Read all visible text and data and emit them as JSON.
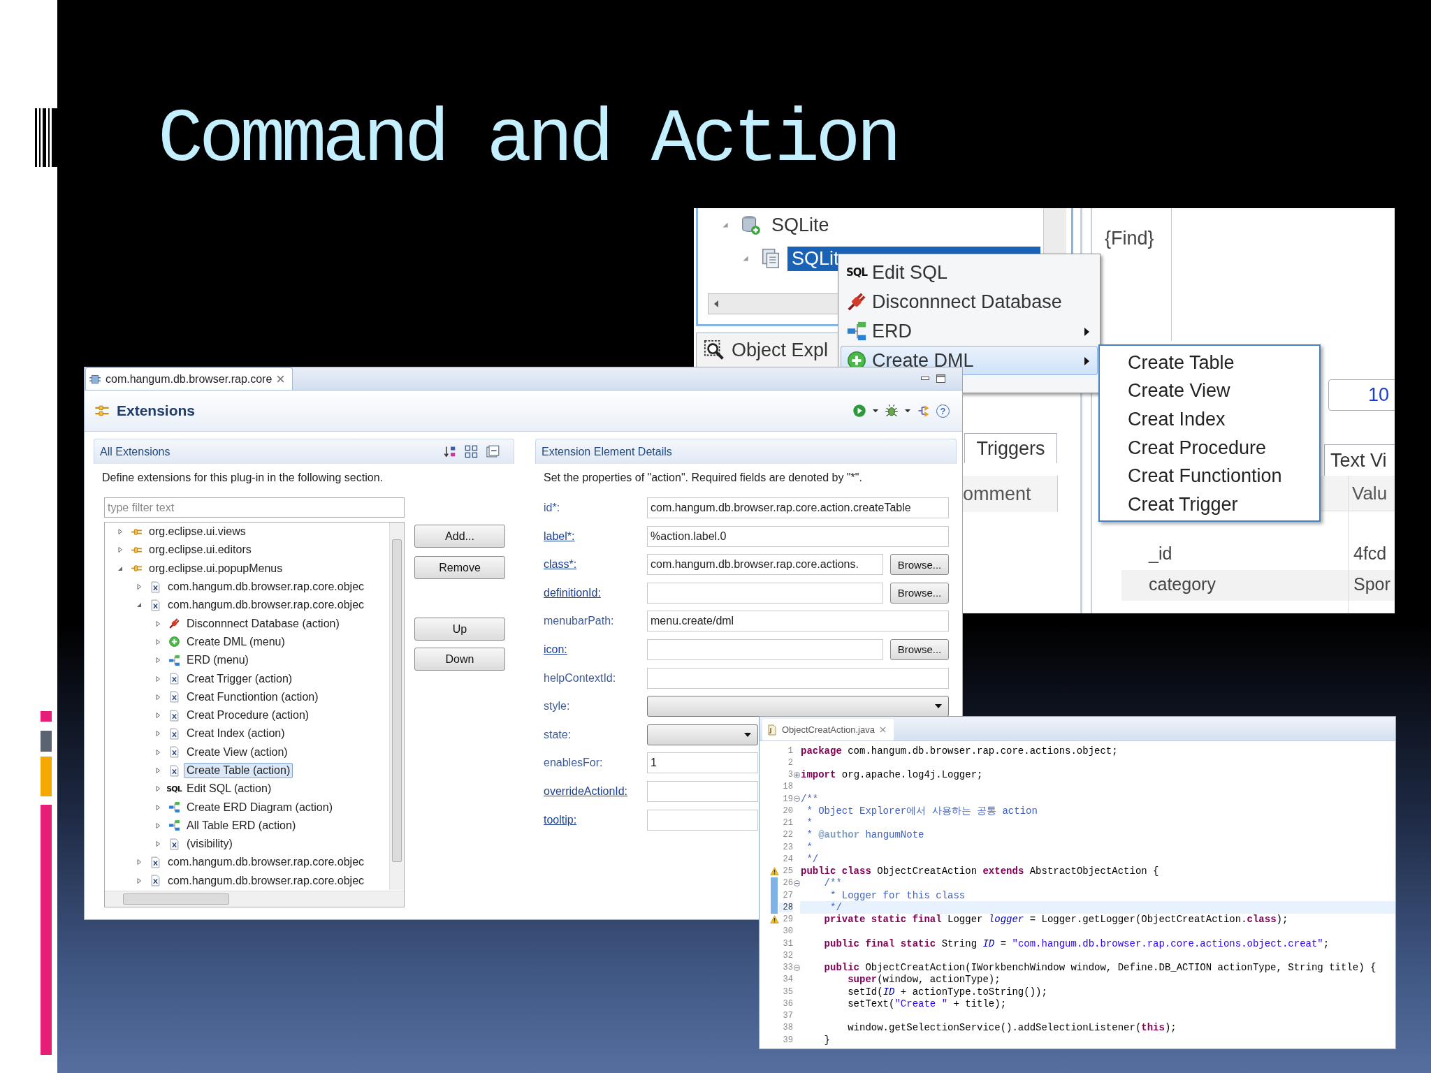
{
  "slide": {
    "title": "Command and Action"
  },
  "explorer_window": {
    "tree": [
      {
        "label": "SQLite",
        "kind": "database",
        "expanded": true,
        "selected": false,
        "children": [
          {
            "label": "SQLit",
            "kind": "db-file",
            "expanded": true,
            "selected": true
          }
        ]
      }
    ],
    "view_tab": {
      "label": "Object Expl"
    },
    "find_label": "{Find}",
    "triggers_tab": "Triggers",
    "column_header": "omment",
    "field_value": "10",
    "text_view_tab": "Text Vi",
    "value_header": "Valu",
    "rows": [
      {
        "key": "_id",
        "value": "4fcd"
      },
      {
        "key": "category",
        "value": "Spor"
      }
    ],
    "context_menu": [
      {
        "label": "Edit SQL",
        "kind": "sql",
        "icon_text": "SQL",
        "submenu": false,
        "selected": false
      },
      {
        "label": "Disconnnect Database",
        "kind": "plug",
        "submenu": false,
        "selected": false
      },
      {
        "label": "ERD",
        "kind": "erd",
        "submenu": true,
        "selected": false
      },
      {
        "label": "Create DML",
        "kind": "dml",
        "submenu": true,
        "selected": true
      }
    ],
    "submenu": [
      {
        "label": "Create Table"
      },
      {
        "label": "Create View"
      },
      {
        "label": "Creat Index"
      },
      {
        "label": "Creat Procedure"
      },
      {
        "label": "Creat Functiontion"
      },
      {
        "label": "Creat Trigger"
      }
    ]
  },
  "plugin_editor": {
    "tab": {
      "label": "com.hangum.db.browser.rap.core"
    },
    "title": "Extensions",
    "toolbar": [
      {
        "kind": "run"
      },
      {
        "kind": "caret"
      },
      {
        "kind": "debug"
      },
      {
        "kind": "caret"
      },
      {
        "kind": "plugin"
      },
      {
        "kind": "help",
        "label": "?"
      }
    ],
    "all_extensions": {
      "title": "All Extensions",
      "description": "Define extensions for this plug-in in the following section.",
      "filter": {
        "placeholder": "type filter text"
      },
      "tree": [
        {
          "label": "org.eclipse.ui.views",
          "kind": "extension-point",
          "expanded": false,
          "selected": false
        },
        {
          "label": "org.eclipse.ui.editors",
          "kind": "extension-point",
          "expanded": false,
          "selected": false
        },
        {
          "label": "org.eclipse.ui.popupMenus",
          "kind": "extension-point",
          "expanded": true,
          "selected": false,
          "children": [
            {
              "label": "com.hangum.db.browser.rap.core.objec",
              "kind": "x-file",
              "expanded": false,
              "selected": false
            },
            {
              "label": "com.hangum.db.browser.rap.core.objec",
              "kind": "x-file",
              "expanded": true,
              "selected": false,
              "children": [
                {
                  "label": "Disconnnect Database (action)",
                  "kind": "plug",
                  "expanded": false,
                  "selected": false
                },
                {
                  "label": "Create DML (menu)",
                  "kind": "dml",
                  "expanded": false,
                  "selected": false
                },
                {
                  "label": "ERD (menu)",
                  "kind": "erd",
                  "expanded": false,
                  "selected": false
                },
                {
                  "label": "Creat Trigger (action)",
                  "kind": "x-file",
                  "expanded": false,
                  "selected": false
                },
                {
                  "label": "Creat Functiontion (action)",
                  "kind": "x-file",
                  "expanded": false,
                  "selected": false
                },
                {
                  "label": "Creat Procedure (action)",
                  "kind": "x-file",
                  "expanded": false,
                  "selected": false
                },
                {
                  "label": "Creat Index (action)",
                  "kind": "x-file",
                  "expanded": false,
                  "selected": false
                },
                {
                  "label": "Create View (action)",
                  "kind": "x-file",
                  "expanded": false,
                  "selected": false
                },
                {
                  "label": "Create Table (action)",
                  "kind": "x-file",
                  "expanded": false,
                  "selected": true
                },
                {
                  "label": "Edit SQL (action)",
                  "kind": "sql",
                  "icon_text": "SQL",
                  "expanded": false,
                  "selected": false
                },
                {
                  "label": "Create ERD Diagram (action)",
                  "kind": "erd",
                  "expanded": false,
                  "selected": false
                },
                {
                  "label": "All Table ERD (action)",
                  "kind": "erd",
                  "expanded": false,
                  "selected": false
                },
                {
                  "label": "(visibility)",
                  "kind": "x-file",
                  "expanded": false,
                  "selected": false
                }
              ]
            },
            {
              "label": "com.hangum.db.browser.rap.core.objec",
              "kind": "x-file",
              "expanded": false,
              "selected": false
            },
            {
              "label": "com.hangum.db.browser.rap.core.objec",
              "kind": "x-file",
              "expanded": false,
              "selected": false
            }
          ]
        }
      ],
      "button_groups": [
        {
          "buttons": [
            {
              "label": "Add..."
            },
            {
              "label": "Remove"
            }
          ]
        },
        {
          "buttons": [
            {
              "label": "Up"
            },
            {
              "label": "Down"
            }
          ]
        }
      ]
    },
    "details": {
      "title": "Extension Element Details",
      "description": "Set the properties of \"action\". Required fields are denoted by \"*\".",
      "fields": [
        {
          "label": "id*:",
          "kind": "text",
          "link": false,
          "value": "com.hangum.db.browser.rap.core.action.createTable"
        },
        {
          "label": "label*:",
          "kind": "text",
          "link": true,
          "value": "%action.label.0"
        },
        {
          "label": "class*:",
          "kind": "browse",
          "link": true,
          "value": "com.hangum.db.browser.rap.core.actions.",
          "button": "Browse..."
        },
        {
          "label": "definitionId:",
          "kind": "browse",
          "link": true,
          "button": "Browse..."
        },
        {
          "label": "menubarPath:",
          "kind": "text",
          "link": false,
          "value": "menu.create/dml"
        },
        {
          "label": "icon:",
          "kind": "browse",
          "link": true,
          "button": "Browse..."
        },
        {
          "label": "helpContextId:",
          "kind": "text",
          "link": false
        },
        {
          "label": "style:",
          "kind": "combo",
          "link": false
        },
        {
          "label": "state:",
          "kind": "combo",
          "link": false
        },
        {
          "label": "enablesFor:",
          "kind": "text",
          "link": false,
          "value": "1"
        },
        {
          "label": "overrideActionId:",
          "kind": "text",
          "link": true
        },
        {
          "label": "tooltip:",
          "kind": "text",
          "link": true
        }
      ]
    }
  },
  "code_editor": {
    "tab": {
      "label": "ObjectCreatAction.java"
    },
    "lines": [
      {
        "number": "1",
        "current": false,
        "tokens": [
          {
            "kind": "keyword",
            "text": "package"
          },
          {
            "kind": "plain",
            "text": " com.hangum.db.browser.rap.core.actions.object;"
          }
        ]
      },
      {
        "number": "2",
        "current": false
      },
      {
        "number": "3",
        "current": false,
        "fold": {
          "collapsed": true
        },
        "tokens": [
          {
            "kind": "keyword",
            "text": "import"
          },
          {
            "kind": "plain",
            "text": " org.apache.log4j.Logger;"
          }
        ]
      },
      {
        "number": "18",
        "current": false
      },
      {
        "number": "19",
        "current": false,
        "fold": {
          "collapsed": false
        },
        "tokens": [
          {
            "kind": "comment",
            "text": "/**"
          }
        ]
      },
      {
        "number": "20",
        "current": false,
        "tokens": [
          {
            "kind": "comment",
            "text": " * Object Explorer에서 사용하는 공통 action"
          }
        ]
      },
      {
        "number": "21",
        "current": false,
        "tokens": [
          {
            "kind": "comment",
            "text": " *"
          }
        ]
      },
      {
        "number": "22",
        "current": false,
        "tokens": [
          {
            "kind": "comment",
            "text": " * "
          },
          {
            "kind": "doc-tag",
            "text": "@author"
          },
          {
            "kind": "comment",
            "text": " hangumNote"
          }
        ]
      },
      {
        "number": "23",
        "current": false,
        "tokens": [
          {
            "kind": "comment",
            "text": " *"
          }
        ]
      },
      {
        "number": "24",
        "current": false,
        "tokens": [
          {
            "kind": "comment",
            "text": " */"
          }
        ]
      },
      {
        "number": "25",
        "current": false,
        "warning": true,
        "tokens": [
          {
            "kind": "keyword",
            "text": "public class"
          },
          {
            "kind": "plain",
            "text": " ObjectCreatAction "
          },
          {
            "kind": "keyword",
            "text": "extends"
          },
          {
            "kind": "plain",
            "text": " AbstractObjectAction {"
          }
        ]
      },
      {
        "number": "26",
        "current": false,
        "changed": true,
        "fold": {
          "collapsed": false
        },
        "tokens": [
          {
            "kind": "comment",
            "text": "    /**"
          }
        ]
      },
      {
        "number": "27",
        "current": false,
        "changed": true,
        "tokens": [
          {
            "kind": "comment",
            "text": "     * Logger for this class"
          }
        ]
      },
      {
        "number": "28",
        "current": true,
        "changed": true,
        "tokens": [
          {
            "kind": "comment",
            "text": "     */"
          }
        ]
      },
      {
        "number": "29",
        "current": false,
        "warning": true,
        "tokens": [
          {
            "kind": "keyword",
            "text": "    private static final"
          },
          {
            "kind": "plain",
            "text": " Logger "
          },
          {
            "kind": "field",
            "text": "logger"
          },
          {
            "kind": "plain",
            "text": " = Logger.getLogger(ObjectCreatAction."
          },
          {
            "kind": "keyword",
            "text": "class"
          },
          {
            "kind": "plain",
            "text": ");"
          }
        ]
      },
      {
        "number": "30",
        "current": false
      },
      {
        "number": "31",
        "current": false,
        "tokens": [
          {
            "kind": "keyword",
            "text": "    public final static"
          },
          {
            "kind": "plain",
            "text": " String "
          },
          {
            "kind": "field",
            "text": "ID"
          },
          {
            "kind": "plain",
            "text": " = "
          },
          {
            "kind": "string",
            "text": "\"com.hangum.db.browser.rap.core.actions.object.creat\""
          },
          {
            "kind": "plain",
            "text": ";"
          }
        ]
      },
      {
        "number": "32",
        "current": false
      },
      {
        "number": "33",
        "current": false,
        "fold": {
          "collapsed": false
        },
        "tokens": [
          {
            "kind": "keyword",
            "text": "    public"
          },
          {
            "kind": "plain",
            "text": " ObjectCreatAction(IWorkbenchWindow window, Define.DB_ACTION actionType, String title) {"
          }
        ]
      },
      {
        "number": "34",
        "current": false,
        "tokens": [
          {
            "kind": "keyword",
            "text": "        super"
          },
          {
            "kind": "plain",
            "text": "(window, actionType);"
          }
        ]
      },
      {
        "number": "35",
        "current": false,
        "tokens": [
          {
            "kind": "plain",
            "text": "        setId("
          },
          {
            "kind": "field",
            "text": "ID"
          },
          {
            "kind": "plain",
            "text": " + actionType.toString());"
          }
        ]
      },
      {
        "number": "36",
        "current": false,
        "tokens": [
          {
            "kind": "plain",
            "text": "        setText("
          },
          {
            "kind": "string",
            "text": "\"Create \""
          },
          {
            "kind": "plain",
            "text": " + title);"
          }
        ]
      },
      {
        "number": "37",
        "current": false
      },
      {
        "number": "38",
        "current": false,
        "tokens": [
          {
            "kind": "plain",
            "text": "        window.getSelectionService().addSelectionListener("
          },
          {
            "kind": "keyword",
            "text": "this"
          },
          {
            "kind": "plain",
            "text": ");"
          }
        ]
      },
      {
        "number": "39",
        "current": false,
        "tokens": [
          {
            "kind": "plain",
            "text": "    }"
          }
        ]
      }
    ]
  }
}
